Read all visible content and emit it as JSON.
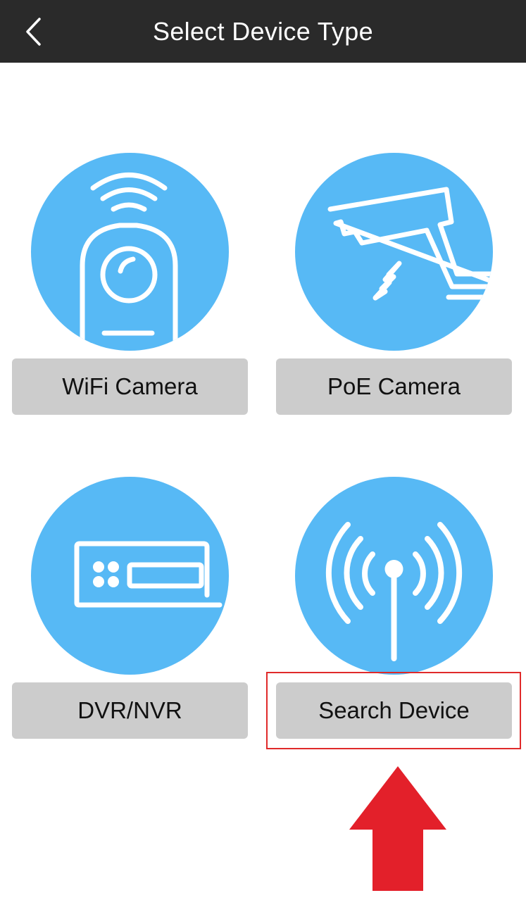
{
  "header": {
    "title": "Select Device Type"
  },
  "icons": {
    "back": "chevron-left-icon",
    "wifi_camera": "wifi-camera-icon",
    "poe_camera": "poe-camera-icon",
    "dvr_nvr": "dvr-nvr-icon",
    "search_device": "antenna-signal-icon",
    "annotation_arrow": "up-arrow-icon"
  },
  "tiles": [
    {
      "label": "WiFi Camera"
    },
    {
      "label": "PoE Camera"
    },
    {
      "label": "DVR/NVR"
    },
    {
      "label": "Search Device"
    }
  ],
  "colors": {
    "header_bg": "#2a2a2a",
    "accent_circle": "#57b9f5",
    "button_bg": "#cccccc",
    "annotation_red": "#e3202a"
  }
}
